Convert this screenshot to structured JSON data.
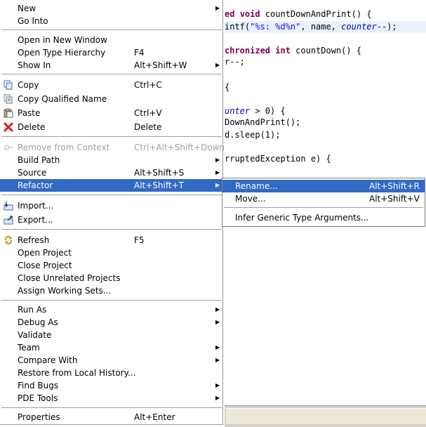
{
  "editor": {
    "lines": [
      {
        "parts": [
          {
            "t": "ed ",
            "c": "kw"
          },
          {
            "t": "void ",
            "c": "kw"
          },
          {
            "t": "countDownAndPrint() {",
            "c": ""
          }
        ]
      },
      {
        "parts": [
          {
            "t": "intf(",
            "c": ""
          },
          {
            "t": "\"%s: %d%n\"",
            "c": "str"
          },
          {
            "t": ", name, ",
            "c": ""
          },
          {
            "t": "counter",
            "c": "it"
          },
          {
            "t": "--);",
            "c": ""
          }
        ]
      },
      {
        "parts": [
          {
            "t": "",
            "c": ""
          }
        ]
      },
      {
        "parts": [
          {
            "t": "chronized ",
            "c": "kw"
          },
          {
            "t": "int ",
            "c": "kw"
          },
          {
            "t": "countDown() {",
            "c": ""
          }
        ]
      },
      {
        "parts": [
          {
            "t": "r--;",
            "c": ""
          }
        ]
      },
      {
        "parts": [
          {
            "t": "",
            "c": ""
          }
        ]
      },
      {
        "parts": [
          {
            "t": "{",
            "c": ""
          }
        ]
      },
      {
        "parts": [
          {
            "t": "",
            "c": ""
          }
        ]
      },
      {
        "parts": [
          {
            "t": "unter",
            "c": "it"
          },
          {
            "t": " > 0) {",
            "c": ""
          }
        ]
      },
      {
        "parts": [
          {
            "t": "DownAndPrint();",
            "c": ""
          }
        ]
      },
      {
        "parts": [
          {
            "t": "d.sleep(1);",
            "c": ""
          }
        ]
      },
      {
        "parts": [
          {
            "t": "",
            "c": ""
          }
        ]
      },
      {
        "parts": [
          {
            "t": "rruptedException e) {",
            "c": ""
          }
        ]
      }
    ]
  },
  "menu": {
    "new": {
      "label": "New"
    },
    "go_into": {
      "label": "Go Into"
    },
    "open_new_window": {
      "label": "Open in New Window"
    },
    "open_type_hierarchy": {
      "label": "Open Type Hierarchy",
      "accel": "F4"
    },
    "show_in": {
      "label": "Show In",
      "accel": "Alt+Shift+W"
    },
    "copy": {
      "label": "Copy",
      "accel": "Ctrl+C",
      "icon": "copy-icon"
    },
    "copy_qualified_name": {
      "label": "Copy Qualified Name",
      "icon": "copy-qualified-icon"
    },
    "paste": {
      "label": "Paste",
      "accel": "Ctrl+V",
      "icon": "paste-icon"
    },
    "delete": {
      "label": "Delete",
      "accel": "Delete",
      "icon": "delete-icon",
      "icon_color": "#d42020"
    },
    "remove_from_context": {
      "label": "Remove from Context",
      "accel": "Ctrl+Alt+Shift+Down",
      "icon": "remove-context-icon"
    },
    "build_path": {
      "label": "Build Path"
    },
    "source": {
      "label": "Source",
      "accel": "Alt+Shift+S"
    },
    "refactor": {
      "label": "Refactor",
      "accel": "Alt+Shift+T"
    },
    "import": {
      "label": "Import...",
      "icon": "import-icon"
    },
    "export": {
      "label": "Export...",
      "icon": "export-icon"
    },
    "refresh": {
      "label": "Refresh",
      "accel": "F5",
      "icon": "refresh-icon"
    },
    "open_project": {
      "label": "Open Project"
    },
    "close_project": {
      "label": "Close Project"
    },
    "close_unrelated": {
      "label": "Close Unrelated Projects"
    },
    "assign_working_sets": {
      "label": "Assign Working Sets..."
    },
    "run_as": {
      "label": "Run As"
    },
    "debug_as": {
      "label": "Debug As"
    },
    "validate": {
      "label": "Validate"
    },
    "team": {
      "label": "Team"
    },
    "compare_with": {
      "label": "Compare With"
    },
    "restore_history": {
      "label": "Restore from Local History..."
    },
    "find_bugs": {
      "label": "Find Bugs"
    },
    "pde_tools": {
      "label": "PDE Tools"
    },
    "properties": {
      "label": "Properties",
      "accel": "Alt+Enter"
    }
  },
  "submenu": {
    "rename": {
      "label": "Rename...",
      "accel": "Alt+Shift+R"
    },
    "move": {
      "label": "Move...",
      "accel": "Alt+Shift+V"
    },
    "infer_generic": {
      "label": "Infer Generic Type Arguments..."
    }
  },
  "colors": {
    "highlight": "#316ac5",
    "disabled": "#a0a0a0",
    "menu_border": "#9a9a9a"
  }
}
